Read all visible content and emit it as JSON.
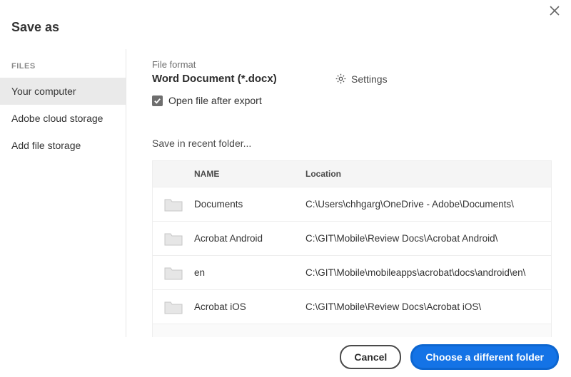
{
  "dialog": {
    "title": "Save as"
  },
  "sidebar": {
    "heading": "FILES",
    "items": [
      {
        "label": "Your computer",
        "selected": true
      },
      {
        "label": "Adobe cloud storage",
        "selected": false
      },
      {
        "label": "Add file storage",
        "selected": false
      }
    ]
  },
  "format": {
    "label": "File format",
    "value": "Word Document (*.docx)",
    "settings_label": "Settings",
    "open_after_export_checked": true,
    "open_after_export_label": "Open file after export"
  },
  "recent": {
    "label": "Save in recent folder...",
    "columns": {
      "name": "NAME",
      "location": "Location"
    },
    "rows": [
      {
        "name": "Documents",
        "location": "C:\\Users\\chhgarg\\OneDrive - Adobe\\Documents\\"
      },
      {
        "name": "Acrobat Android",
        "location": "C:\\GIT\\Mobile\\Review Docs\\Acrobat Android\\"
      },
      {
        "name": "en",
        "location": "C:\\GIT\\Mobile\\mobileapps\\acrobat\\docs\\android\\en\\"
      },
      {
        "name": "Acrobat iOS",
        "location": "C:\\GIT\\Mobile\\Review Docs\\Acrobat iOS\\"
      }
    ]
  },
  "footer": {
    "cancel": "Cancel",
    "choose": "Choose a different folder"
  }
}
